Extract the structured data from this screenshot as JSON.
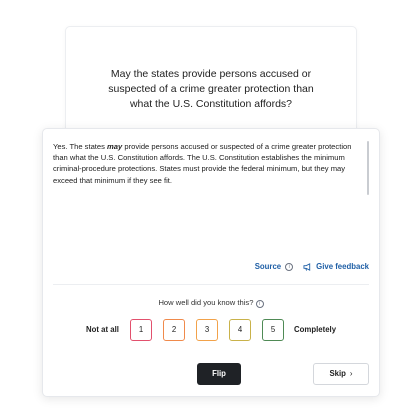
{
  "question": {
    "text": "May the states provide persons accused or suspected of a crime greater protection than what the U.S. Constitution affords?"
  },
  "answer": {
    "lead": "Yes. The states ",
    "emphasis": "may",
    "rest": " provide persons accused or suspected of a crime greater protection than what the U.S. Constitution affords. The U.S. Constitution establishes the minimum criminal-procedure protections. States must provide the federal minimum, but they may exceed that minimum if they see fit."
  },
  "links": {
    "source_label": "Source",
    "info_glyph": "i",
    "feedback_label": "Give feedback",
    "megaphone_icon": "megaphone-icon"
  },
  "rating": {
    "question": "How well did you know this?",
    "info_glyph": "i",
    "low_label": "Not at all",
    "high_label": "Completely",
    "options": [
      {
        "label": "1",
        "color": "#e2506d"
      },
      {
        "label": "2",
        "color": "#f08a4b"
      },
      {
        "label": "3",
        "color": "#f2a24a"
      },
      {
        "label": "4",
        "color": "#c9b24a"
      },
      {
        "label": "5",
        "color": "#4f8a55"
      }
    ]
  },
  "actions": {
    "flip_label": "Flip",
    "skip_label": "Skip",
    "skip_chevron": "›"
  }
}
